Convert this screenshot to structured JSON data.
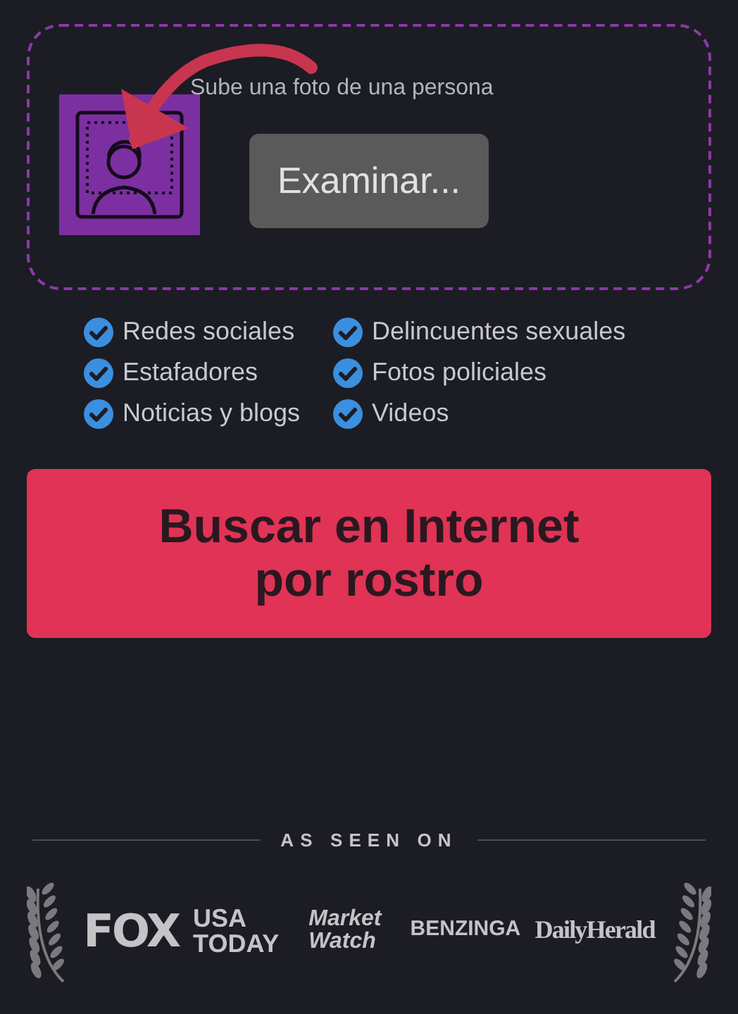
{
  "upload": {
    "prompt": "Sube una foto de una persona",
    "browse_button": "Examinar..."
  },
  "sources": [
    {
      "label": "Redes sociales",
      "checked": true
    },
    {
      "label": "Delincuentes sexuales",
      "checked": true
    },
    {
      "label": "Estafadores",
      "checked": true
    },
    {
      "label": "Fotos policiales",
      "checked": true
    },
    {
      "label": "Noticias y blogs",
      "checked": true
    },
    {
      "label": "Videos",
      "checked": true
    }
  ],
  "search_button": "Buscar en Internet por rostro",
  "press": {
    "heading": "AS SEEN ON",
    "logos": [
      {
        "kind": "fox",
        "text": "FOX"
      },
      {
        "kind": "usatoday",
        "text": "USA TODAY"
      },
      {
        "kind": "marketwatch",
        "text": "Market Watch"
      },
      {
        "kind": "benzinga",
        "text": "BENZINGA"
      },
      {
        "kind": "dailyherald",
        "text": "DailyHerald"
      }
    ]
  }
}
